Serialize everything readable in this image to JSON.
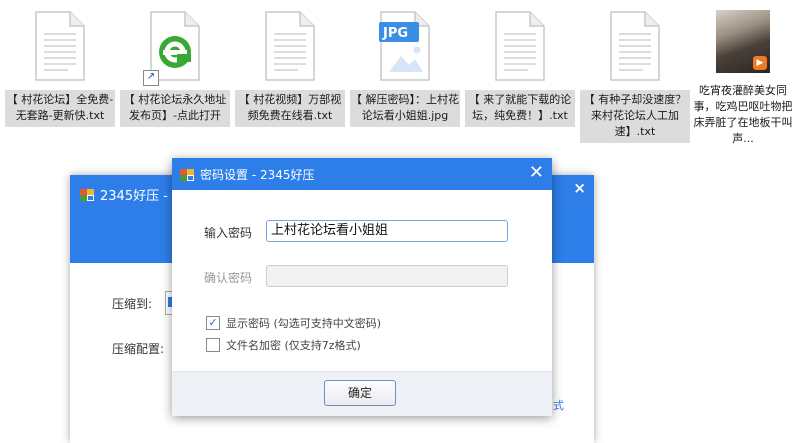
{
  "desktop": {
    "files": [
      {
        "label": "【 村花论坛】全免费-无套路-更新快.txt",
        "icon": "text-file-icon"
      },
      {
        "label": "【 村花论坛永久地址发布页】-点此打开",
        "icon": "ie-browser-shortcut-icon"
      },
      {
        "label": "【 村花视频】万部视频免费在线看.txt",
        "icon": "text-file-icon"
      },
      {
        "label": "【 解压密码】：上村花论坛看小姐姐.jpg",
        "icon": "jpg-file-icon",
        "badge": "JPG"
      },
      {
        "label": "【 来了就能下载的论坛，纯免费！】.txt",
        "icon": "text-file-icon"
      },
      {
        "label": "【 有种子却没速度？来村花论坛人工加速】.txt",
        "icon": "text-file-icon"
      },
      {
        "label": "吃宵夜灌醉美女同事，吃鸡巴呕吐物把床弄脏了在地板干叫声...",
        "icon": "video-thumbnail-icon"
      }
    ]
  },
  "main_window": {
    "title": "2345好压 -",
    "close": "×",
    "compress_to_label": "压缩到:",
    "compress_config_label": "压缩配置:",
    "link_fragment": "式"
  },
  "dialog": {
    "title": "密码设置 - 2345好压",
    "close": "✕",
    "password_label": "输入密码",
    "password_value": "上村花论坛看小姐姐",
    "confirm_label": "确认密码",
    "confirm_value": "",
    "show_password": {
      "label": "显示密码 (勾选可支持中文密码)",
      "checked": true
    },
    "encrypt_filenames": {
      "label": "文件名加密 (仅支持7z格式)",
      "checked": false
    },
    "ok_button": "确定"
  },
  "colors": {
    "accent": "#2d7ee8",
    "label_bg": "#dcdcdc",
    "ie_green": "#3aa835",
    "jpg_blue": "#3a8ee6"
  }
}
